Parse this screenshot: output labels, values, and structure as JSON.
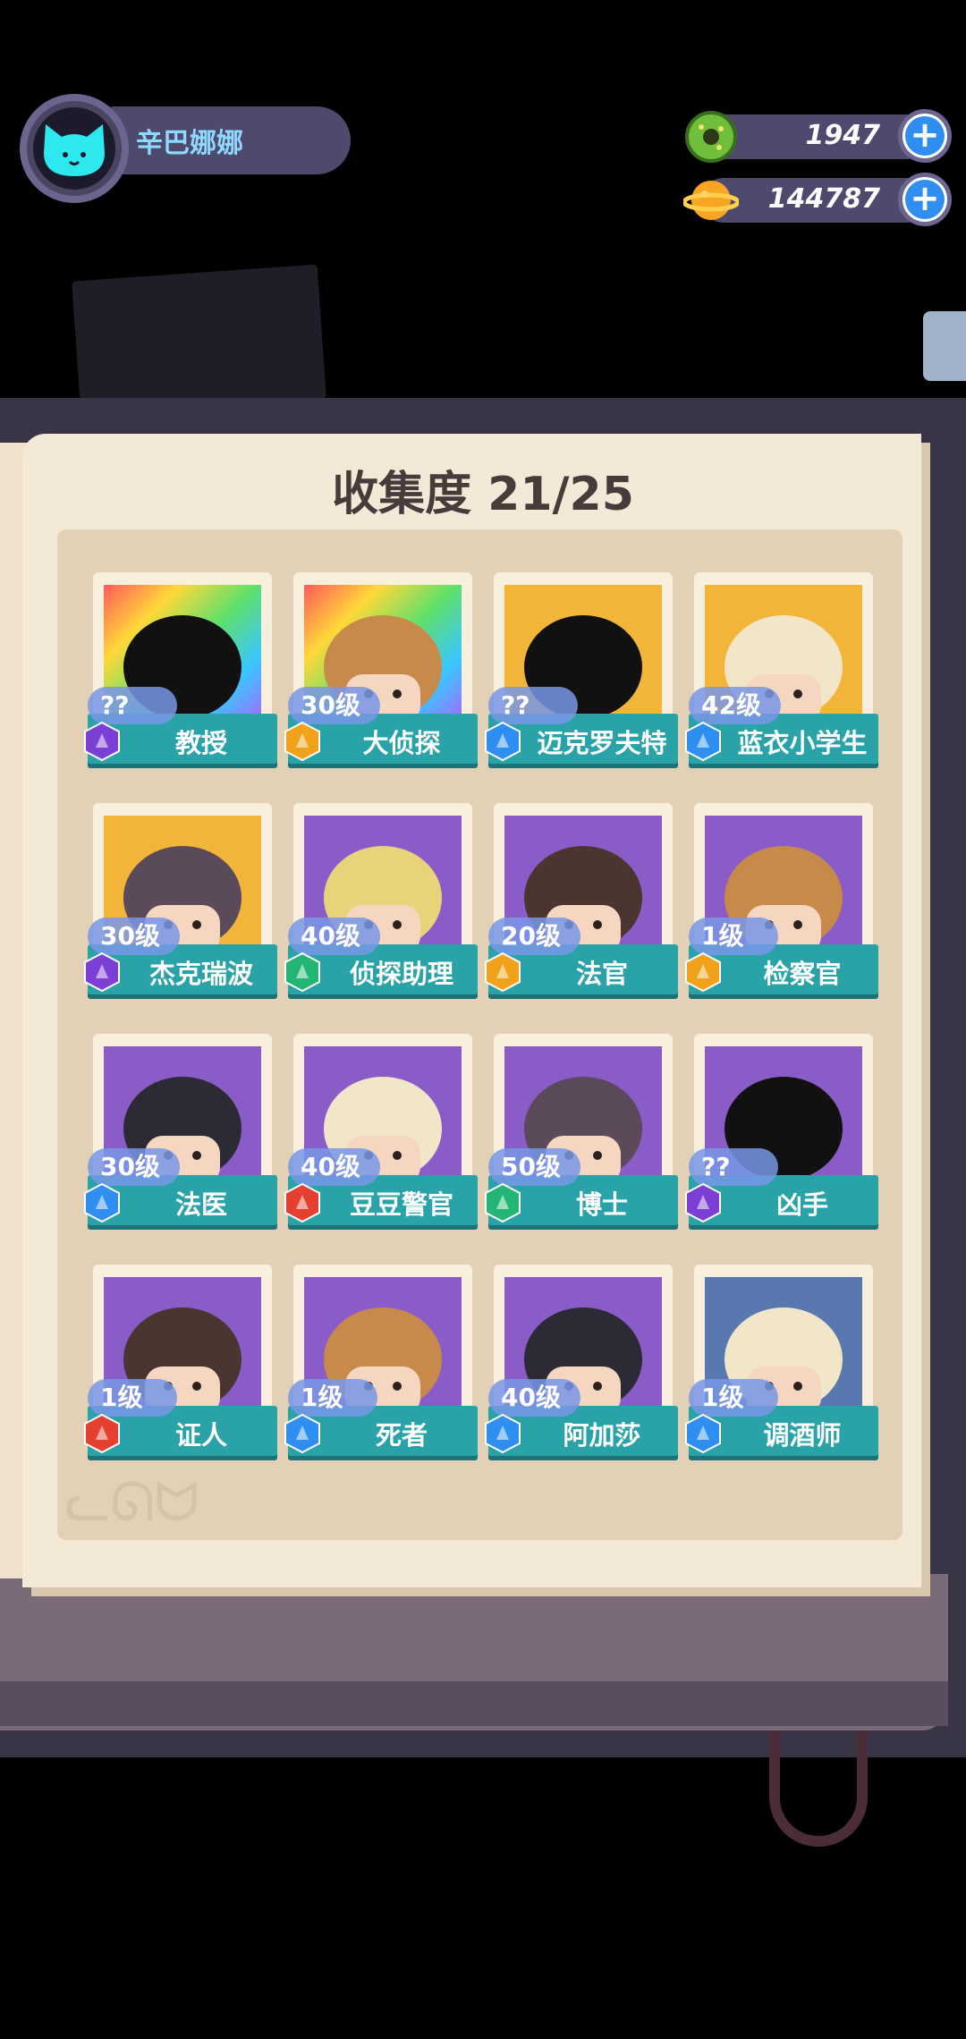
{
  "player": {
    "name": "辛巴娜娜"
  },
  "currencies": [
    {
      "icon": "donut-icon",
      "value": "1947"
    },
    {
      "icon": "planet-icon",
      "value": "144787"
    }
  ],
  "collection": {
    "title": "收集度 21/25",
    "characters": [
      {
        "name": "教授",
        "level": "??",
        "portrait": "rainbow",
        "rarity": "purple",
        "silhouette": true
      },
      {
        "name": "大侦探",
        "level": "30级",
        "portrait": "rainbow",
        "rarity": "gold",
        "silhouette": false
      },
      {
        "name": "迈克罗夫特",
        "level": "??",
        "portrait": "gold",
        "rarity": "blue",
        "silhouette": true
      },
      {
        "name": "蓝衣小学生",
        "level": "42级",
        "portrait": "gold",
        "rarity": "blue",
        "silhouette": false
      },
      {
        "name": "杰克瑞波",
        "level": "30级",
        "portrait": "gold",
        "rarity": "purple",
        "silhouette": false
      },
      {
        "name": "侦探助理",
        "level": "40级",
        "portrait": "purple",
        "rarity": "green",
        "silhouette": false
      },
      {
        "name": "法官",
        "level": "20级",
        "portrait": "purple",
        "rarity": "gold",
        "silhouette": false
      },
      {
        "name": "检察官",
        "level": "1级",
        "portrait": "purple",
        "rarity": "gold",
        "silhouette": false
      },
      {
        "name": "法医",
        "level": "30级",
        "portrait": "purple",
        "rarity": "blue",
        "silhouette": false
      },
      {
        "name": "豆豆警官",
        "level": "40级",
        "portrait": "purple",
        "rarity": "red",
        "silhouette": false
      },
      {
        "name": "博士",
        "level": "50级",
        "portrait": "purple",
        "rarity": "green",
        "silhouette": false
      },
      {
        "name": "凶手",
        "level": "??",
        "portrait": "purple",
        "rarity": "purple",
        "silhouette": true
      },
      {
        "name": "证人",
        "level": "1级",
        "portrait": "purple",
        "rarity": "red",
        "silhouette": false
      },
      {
        "name": "死者",
        "level": "1级",
        "portrait": "purple",
        "rarity": "blue",
        "silhouette": false
      },
      {
        "name": "阿加莎",
        "level": "40级",
        "portrait": "purple",
        "rarity": "blue",
        "silhouette": false
      },
      {
        "name": "调酒师",
        "level": "1级",
        "portrait": "blue",
        "rarity": "blue",
        "silhouette": false
      }
    ]
  },
  "colors": {
    "rarity": {
      "purple": "#7b3fd6",
      "gold": "#f0a21a",
      "blue": "#2f8ff0",
      "green": "#22b573",
      "red": "#e5402f"
    },
    "portrait_bg": {
      "purple": "#8a5cc8",
      "gold": "#f2b53a",
      "blue": "#5a78b0",
      "rainbow": "rainbow"
    }
  }
}
